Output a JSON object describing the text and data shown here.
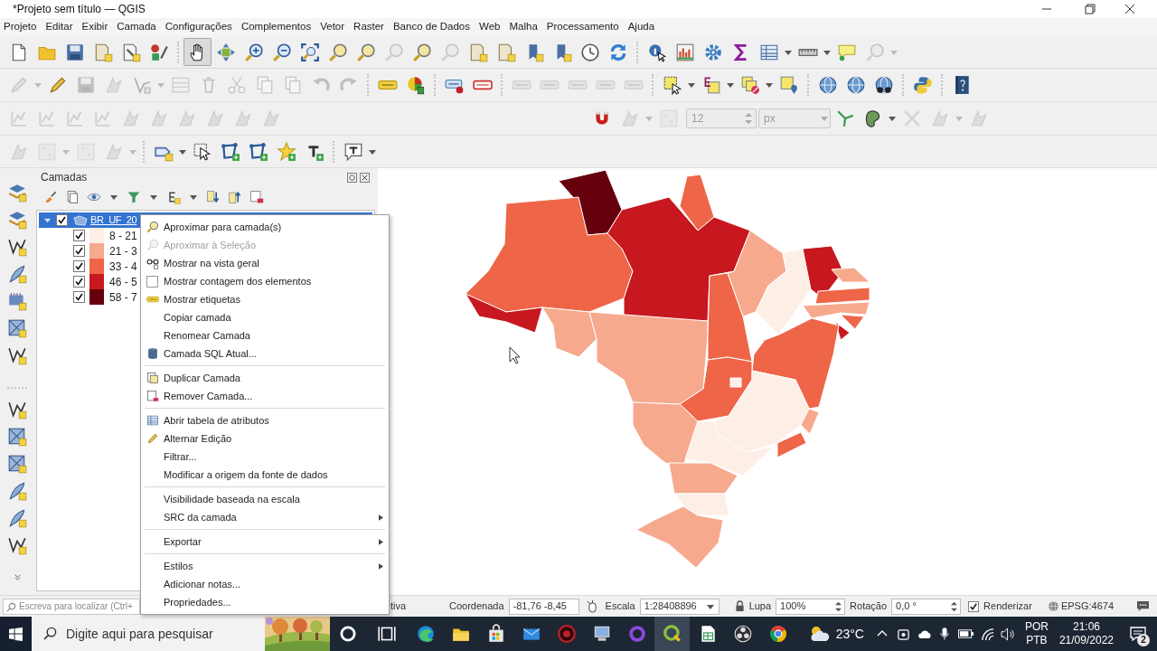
{
  "window": {
    "title": "*Projeto sem título — QGIS"
  },
  "menu": [
    "Projeto",
    "Editar",
    "Exibir",
    "Camada",
    "Configurações",
    "Complementos",
    "Vetor",
    "Raster",
    "Banco de Dados",
    "Web",
    "Malha",
    "Processamento",
    "Ajuda"
  ],
  "toolbar_rows": [
    [
      {
        "buttons": [
          {
            "kind": "button",
            "disabled": false,
            "pressed": false
          },
          {
            "kind": "button",
            "disabled": false,
            "pressed": false
          },
          {
            "kind": "button",
            "disabled": false,
            "pressed": false
          },
          {
            "kind": "button",
            "disabled": false,
            "pressed": false
          },
          {
            "kind": "button",
            "disabled": false,
            "pressed": false
          },
          {
            "kind": "button",
            "disabled": false,
            "pressed": false
          },
          {
            "kind": "separator"
          },
          {
            "kind": "button",
            "disabled": false,
            "pressed": true
          },
          {
            "kind": "button",
            "disabled": false,
            "pressed": false
          },
          {
            "kind": "button",
            "disabled": false,
            "pressed": false
          },
          {
            "kind": "button",
            "disabled": false,
            "pressed": false
          },
          {
            "kind": "button",
            "disabled": false,
            "pressed": false
          },
          {
            "kind": "button",
            "disabled": false,
            "pressed": false
          },
          {
            "kind": "button",
            "disabled": false,
            "pressed": false
          },
          {
            "kind": "button",
            "disabled": true,
            "pressed": false
          },
          {
            "kind": "button",
            "disabled": false,
            "pressed": false
          },
          {
            "kind": "button",
            "disabled": true,
            "pressed": false
          },
          {
            "kind": "button",
            "disabled": false,
            "pressed": false
          },
          {
            "kind": "button",
            "disabled": false,
            "pressed": false
          },
          {
            "kind": "button",
            "disabled": false,
            "pressed": false
          },
          {
            "kind": "button",
            "disabled": false,
            "pressed": false
          },
          {
            "kind": "button",
            "disabled": false,
            "pressed": false
          },
          {
            "kind": "button",
            "disabled": false,
            "pressed": false
          },
          {
            "kind": "separator"
          },
          {
            "kind": "button",
            "disabled": false,
            "pressed": false
          },
          {
            "kind": "button",
            "disabled": false,
            "pressed": false
          },
          {
            "kind": "button",
            "disabled": false,
            "pressed": false
          },
          {
            "kind": "button",
            "disabled": false,
            "pressed": false
          },
          {
            "kind": "button",
            "disabled": false,
            "pressed": false
          },
          {
            "kind": "button",
            "disabled": false,
            "pressed": false
          },
          {
            "kind": "button",
            "disabled": false,
            "pressed": false
          },
          {
            "kind": "button",
            "disabled": true,
            "pressed": false
          }
        ]
      }
    ],
    [
      {
        "buttons": [
          {
            "kind": "button",
            "disabled": true,
            "pressed": false
          },
          {
            "kind": "button",
            "disabled": false,
            "pressed": false
          },
          {
            "kind": "button",
            "disabled": true,
            "pressed": false
          },
          {
            "kind": "button",
            "disabled": true,
            "pressed": false
          },
          {
            "kind": "button",
            "disabled": true,
            "pressed": false
          },
          {
            "kind": "button",
            "disabled": true,
            "pressed": false
          },
          {
            "kind": "button",
            "disabled": true,
            "pressed": false
          },
          {
            "kind": "button",
            "disabled": true,
            "pressed": false
          },
          {
            "kind": "button",
            "disabled": true,
            "pressed": false
          },
          {
            "kind": "button",
            "disabled": true,
            "pressed": false
          },
          {
            "kind": "button",
            "disabled": true,
            "pressed": false
          },
          {
            "kind": "button",
            "disabled": true,
            "pressed": false
          },
          {
            "kind": "separator"
          },
          {
            "kind": "button",
            "disabled": false,
            "pressed": false
          },
          {
            "kind": "button",
            "disabled": false,
            "pressed": false
          },
          {
            "kind": "separator"
          },
          {
            "kind": "button",
            "disabled": false,
            "pressed": false
          },
          {
            "kind": "button",
            "disabled": false,
            "pressed": false
          },
          {
            "kind": "separator"
          },
          {
            "kind": "button",
            "disabled": true,
            "pressed": false
          },
          {
            "kind": "button",
            "disabled": true,
            "pressed": false
          },
          {
            "kind": "button",
            "disabled": true,
            "pressed": false
          },
          {
            "kind": "button",
            "disabled": true,
            "pressed": false
          },
          {
            "kind": "button",
            "disabled": true,
            "pressed": false
          },
          {
            "kind": "separator"
          },
          {
            "kind": "button",
            "disabled": false,
            "pressed": false
          },
          {
            "kind": "button",
            "disabled": false,
            "pressed": false
          },
          {
            "kind": "button",
            "disabled": false,
            "pressed": false
          },
          {
            "kind": "button",
            "disabled": false,
            "pressed": false
          },
          {
            "kind": "separator"
          },
          {
            "kind": "button",
            "disabled": false,
            "pressed": false
          },
          {
            "kind": "button",
            "disabled": false,
            "pressed": false
          },
          {
            "kind": "button",
            "disabled": false,
            "pressed": false
          },
          {
            "kind": "separator"
          },
          {
            "kind": "button",
            "disabled": false,
            "pressed": false
          },
          {
            "kind": "separator"
          },
          {
            "kind": "button",
            "disabled": false,
            "pressed": false
          }
        ]
      }
    ],
    [
      {
        "buttons": [
          {
            "kind": "button",
            "disabled": true,
            "pressed": false
          },
          {
            "kind": "button",
            "disabled": true,
            "pressed": false
          },
          {
            "kind": "button",
            "disabled": true,
            "pressed": false
          },
          {
            "kind": "button",
            "disabled": true,
            "pressed": false
          },
          {
            "kind": "button",
            "disabled": true,
            "pressed": false
          },
          {
            "kind": "button",
            "disabled": true,
            "pressed": false
          },
          {
            "kind": "button",
            "disabled": true,
            "pressed": false
          },
          {
            "kind": "button",
            "disabled": true,
            "pressed": false
          },
          {
            "kind": "button",
            "disabled": true,
            "pressed": false
          },
          {
            "kind": "button",
            "disabled": true,
            "pressed": false
          }
        ]
      },
      {
        "buttons": [
          {
            "kind": "button",
            "disabled": false,
            "pressed": false
          },
          {
            "kind": "button",
            "disabled": true,
            "pressed": false
          },
          {
            "kind": "button",
            "disabled": true,
            "pressed": false
          },
          {
            "kind": "spinbox",
            "value": "12",
            "disabled": true
          },
          {
            "kind": "combobox",
            "value": "px",
            "disabled": true
          },
          {
            "kind": "button",
            "disabled": false,
            "pressed": false
          },
          {
            "kind": "button",
            "disabled": false,
            "pressed": false
          },
          {
            "kind": "button",
            "disabled": true,
            "pressed": false
          },
          {
            "kind": "button",
            "disabled": true,
            "pressed": false
          },
          {
            "kind": "button",
            "disabled": true,
            "pressed": false
          }
        ]
      }
    ],
    [
      {
        "buttons": [
          {
            "kind": "button",
            "disabled": true,
            "pressed": false
          },
          {
            "kind": "button",
            "disabled": true,
            "pressed": false
          },
          {
            "kind": "button",
            "disabled": true,
            "pressed": false
          },
          {
            "kind": "button",
            "disabled": true,
            "pressed": false
          },
          {
            "kind": "separator"
          },
          {
            "kind": "button",
            "disabled": false,
            "pressed": false
          },
          {
            "kind": "button",
            "disabled": false,
            "pressed": false
          },
          {
            "kind": "button",
            "disabled": false,
            "pressed": false
          },
          {
            "kind": "button",
            "disabled": false,
            "pressed": false
          },
          {
            "kind": "button",
            "disabled": false,
            "pressed": false
          },
          {
            "kind": "button",
            "disabled": false,
            "pressed": false
          },
          {
            "kind": "separator"
          },
          {
            "kind": "button",
            "disabled": false,
            "pressed": false
          }
        ]
      }
    ]
  ],
  "layers_panel": {
    "title": "Camadas",
    "layers": [
      {
        "label": "BR_UF_20",
        "checked": true,
        "expanded": true,
        "selected": true,
        "classes": [
          {
            "label": "8 - 21",
            "checked": true,
            "color": "#fdeee6"
          },
          {
            "label": "21 - 3",
            "checked": true,
            "color": "#f6a98d"
          },
          {
            "label": "33 - 4",
            "checked": true,
            "color": "#ee6548"
          },
          {
            "label": "46 - 5",
            "checked": true,
            "color": "#c8181f"
          },
          {
            "label": "58 - 7",
            "checked": true,
            "color": "#67000d"
          }
        ]
      }
    ]
  },
  "context_menu": {
    "items": [
      {
        "kind": "item",
        "label": "Aproximar para camada(s)",
        "disabled": false,
        "submenu": false
      },
      {
        "kind": "item",
        "label": "Aproximar à Seleção",
        "disabled": true,
        "submenu": false
      },
      {
        "kind": "item",
        "label": "Mostrar na vista geral",
        "disabled": false,
        "submenu": false
      },
      {
        "kind": "checkbox",
        "label": "Mostrar contagem dos elementos",
        "checked": false
      },
      {
        "kind": "item",
        "label": "Mostrar etiquetas",
        "disabled": false,
        "submenu": false
      },
      {
        "kind": "item",
        "label": "Copiar camada",
        "disabled": false,
        "submenu": false
      },
      {
        "kind": "item",
        "label": "Renomear Camada",
        "disabled": false,
        "submenu": false
      },
      {
        "kind": "item",
        "label": "Camada SQL Atual...",
        "disabled": false,
        "submenu": false
      },
      {
        "kind": "separator"
      },
      {
        "kind": "item",
        "label": "Duplicar Camada",
        "disabled": false,
        "submenu": false
      },
      {
        "kind": "item",
        "label": "Remover Camada...",
        "disabled": false,
        "submenu": false
      },
      {
        "kind": "separator"
      },
      {
        "kind": "item",
        "label": "Abrir tabela de atributos",
        "disabled": false,
        "submenu": false
      },
      {
        "kind": "item",
        "label": "Alternar Edição",
        "disabled": false,
        "submenu": false
      },
      {
        "kind": "item",
        "label": "Filtrar...",
        "disabled": false,
        "submenu": false
      },
      {
        "kind": "item",
        "label": "Modificar a origem da fonte de dados",
        "disabled": false,
        "submenu": false
      },
      {
        "kind": "separator"
      },
      {
        "kind": "item",
        "label": "Visibilidade baseada na escala",
        "disabled": false,
        "submenu": false
      },
      {
        "kind": "item",
        "label": "SRC da camada",
        "disabled": false,
        "submenu": true
      },
      {
        "kind": "separator"
      },
      {
        "kind": "item",
        "label": "Exportar",
        "disabled": false,
        "submenu": true
      },
      {
        "kind": "separator"
      },
      {
        "kind": "item",
        "label": "Estilos",
        "disabled": false,
        "submenu": true
      },
      {
        "kind": "item",
        "label": "Adicionar notas...",
        "disabled": false,
        "submenu": false
      },
      {
        "kind": "item",
        "label": "Propriedades...",
        "disabled": false,
        "submenu": false
      }
    ]
  },
  "status_bar": {
    "search_placeholder": "Escreva para localizar (Ctrl+",
    "message": "tiva",
    "coordinate_label": "Coordenada",
    "coordinate": "-81,76 -8,45",
    "scale_label": "Escala",
    "scale": "1:28408896",
    "magnifier_label": "Lupa",
    "magnifier": "100%",
    "rotation_label": "Rotação",
    "rotation": "0,0 °",
    "render": {
      "label": "Renderizar",
      "checked": true
    },
    "crs": "EPSG:4674"
  },
  "taskbar": {
    "search_placeholder": "Digite aqui para pesquisar",
    "apps": [
      {
        "active": false
      },
      {
        "active": false
      },
      {
        "active": false
      },
      {
        "active": false
      },
      {
        "active": false
      },
      {
        "active": false
      },
      {
        "active": false
      },
      {
        "active": false
      },
      {
        "active": false
      },
      {
        "active": true
      },
      {
        "active": false
      },
      {
        "active": false
      },
      {
        "active": false
      }
    ],
    "weather": "23°C",
    "language": [
      "POR",
      "PTB"
    ],
    "time": "21:06",
    "date": "21/09/2022",
    "notifications": "2"
  }
}
